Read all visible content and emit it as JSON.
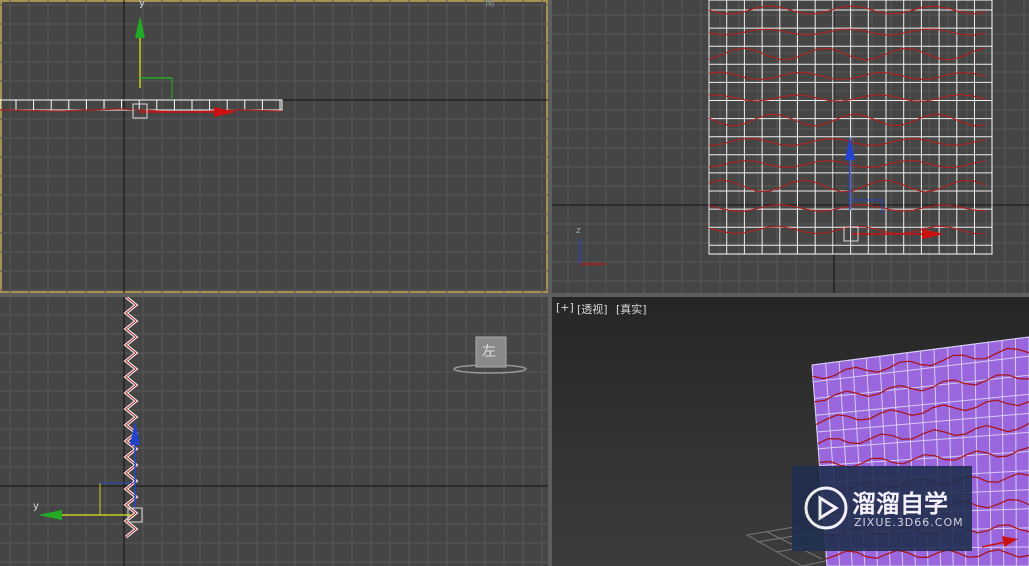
{
  "viewports": {
    "top": {
      "corner_label": "南",
      "axis_y": "y"
    },
    "front": {
      "axis_z": "z"
    },
    "left": {
      "viewcube_face": "左",
      "axis_y": "y"
    },
    "perspective": {
      "menu_plus": "[+]",
      "menu_view": "[透视]",
      "menu_shading": "[真实]"
    }
  },
  "watermark": {
    "brand": "溜溜自学",
    "url": "ZIXUE.3D66.COM"
  },
  "colors": {
    "viewport_bg": "#454545",
    "grid": "#5a5a5a",
    "active_border": "#a89252",
    "axis_x": "#cc1111",
    "axis_y": "#22aa22",
    "axis_z": "#2244cc",
    "object": "#9966dd"
  }
}
